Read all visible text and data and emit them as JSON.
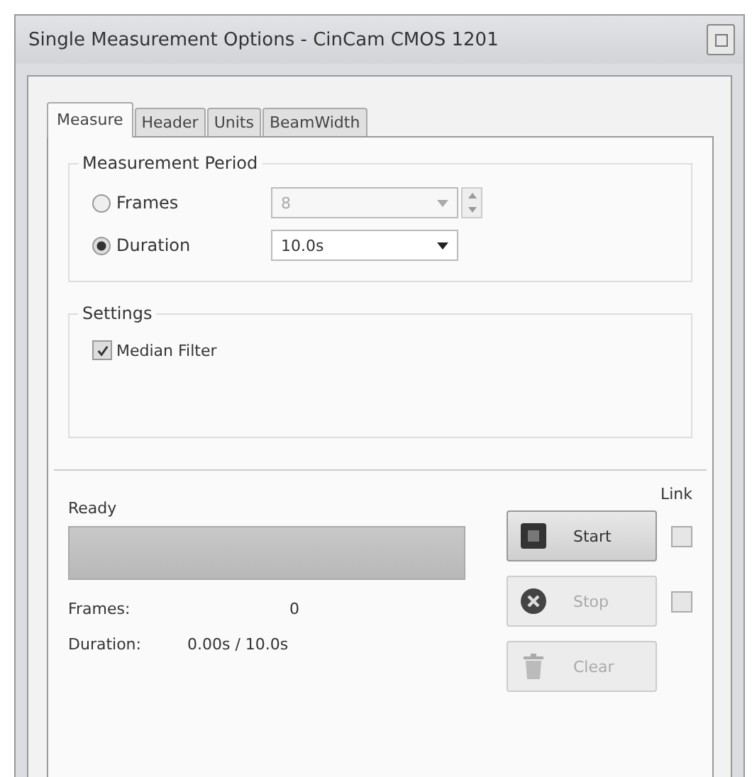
{
  "window": {
    "title": "Single Measurement Options - CinCam CMOS 1201"
  },
  "tabs": [
    {
      "label": "Measure",
      "selected": true
    },
    {
      "label": "Header",
      "selected": false
    },
    {
      "label": "Units",
      "selected": false
    },
    {
      "label": "BeamWidth",
      "selected": false
    }
  ],
  "measurement_period": {
    "title": "Measurement Period",
    "options": [
      {
        "label": "Frames",
        "selected": false,
        "value": "8",
        "disabled": true,
        "spinner": true
      },
      {
        "label": "Duration",
        "selected": true,
        "value": "10.0s",
        "disabled": false
      }
    ]
  },
  "settings": {
    "title": "Settings",
    "median_filter": {
      "label": "Median Filter",
      "checked": true
    }
  },
  "status": {
    "label": "Ready",
    "level": 0
  },
  "link_label": "Link",
  "buttons": [
    {
      "kind": "start",
      "label": "Start",
      "disabled": false,
      "link_checked": false
    },
    {
      "kind": "stop",
      "label": "Stop",
      "disabled": true,
      "link_checked": false
    },
    {
      "kind": "clear",
      "label": "Clear",
      "disabled": true
    }
  ],
  "readouts": [
    {
      "label": "Frames:",
      "value": "0"
    },
    {
      "label": "Duration:",
      "value": "0.00s / 10.0s"
    }
  ]
}
